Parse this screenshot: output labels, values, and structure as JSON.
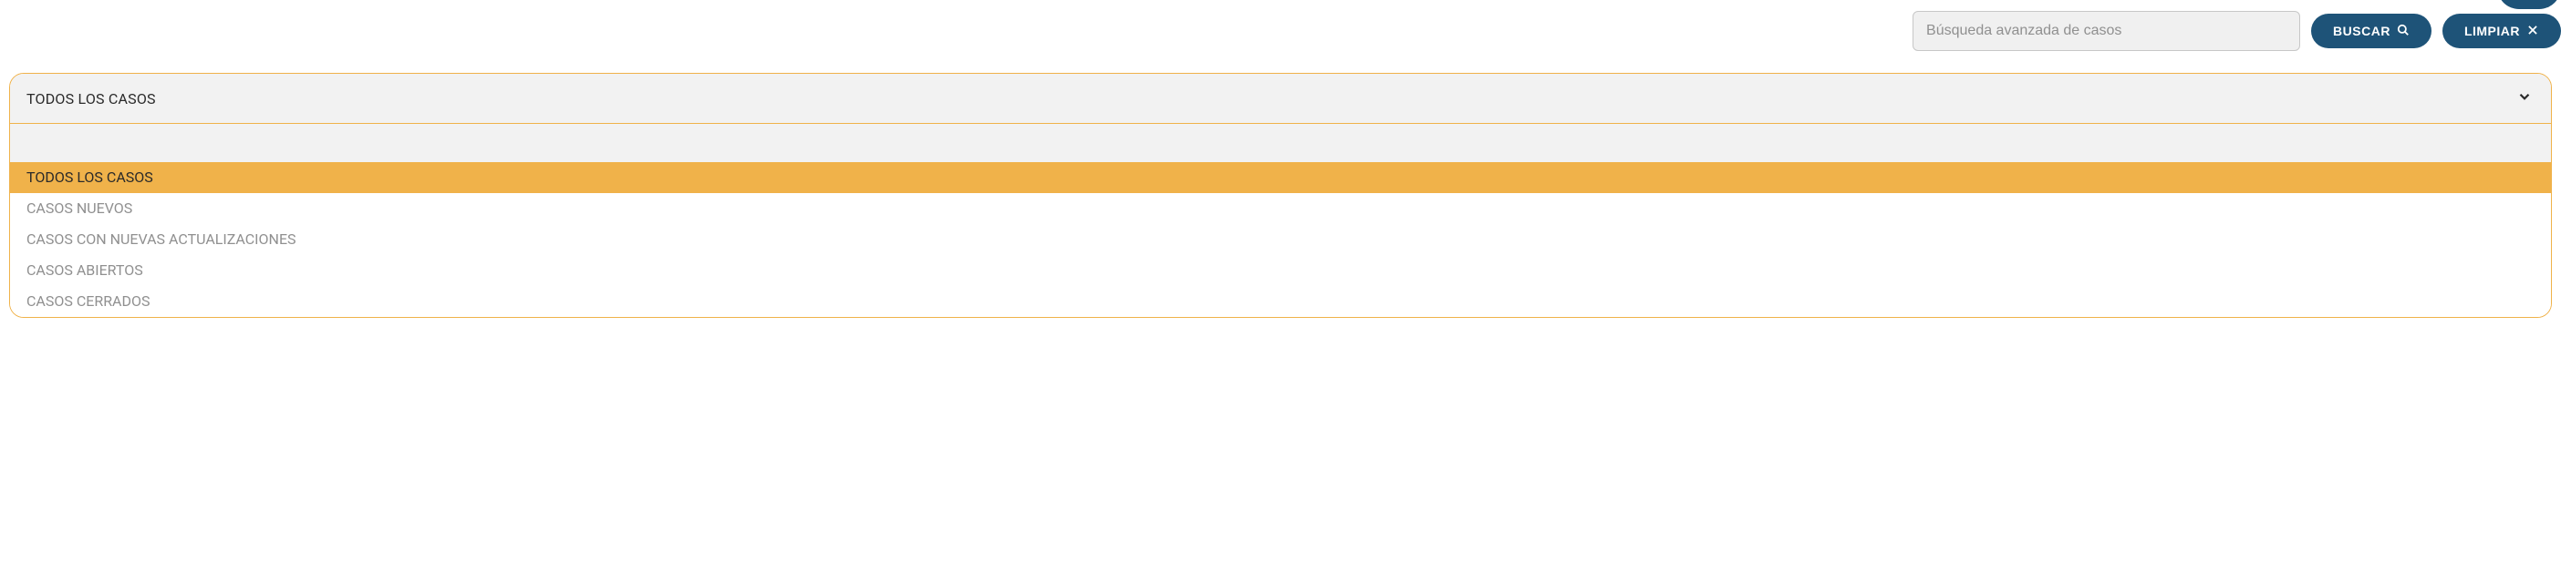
{
  "toolbar": {
    "search_placeholder": "Búsqueda avanzada de casos",
    "search_value": "",
    "buscar_label": "BUSCAR",
    "limpiar_label": "LIMPIAR"
  },
  "dropdown": {
    "current_label": "TODOS LOS CASOS",
    "filter_value": "",
    "options": [
      {
        "label": "TODOS LOS CASOS",
        "selected": true
      },
      {
        "label": "CASOS NUEVOS",
        "selected": false
      },
      {
        "label": "CASOS CON NUEVAS ACTUALIZACIONES",
        "selected": false
      },
      {
        "label": "CASOS ABIERTOS",
        "selected": false
      },
      {
        "label": "CASOS CERRADOS",
        "selected": false
      }
    ]
  }
}
